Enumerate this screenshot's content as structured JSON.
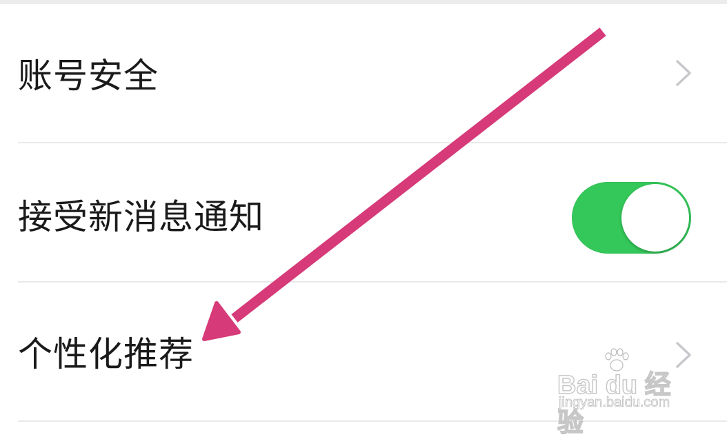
{
  "settings": {
    "rows": [
      {
        "label": "账号安全",
        "control": "chevron-right-icon"
      },
      {
        "label": "接受新消息通知",
        "control": "toggle",
        "toggle_on": true
      },
      {
        "label": "个性化推荐",
        "control": "chevron-right-icon"
      }
    ]
  },
  "colors": {
    "toggle_on": "#34c759",
    "annotation_arrow": "#d63a78",
    "divider": "#e9e9e9",
    "chevron": "#c7c7cc"
  },
  "annotation": {
    "type": "arrow",
    "points_to": "个性化推荐"
  },
  "watermark": {
    "main": "Bai du 经验",
    "sub": "jingyan.baidu.com"
  }
}
